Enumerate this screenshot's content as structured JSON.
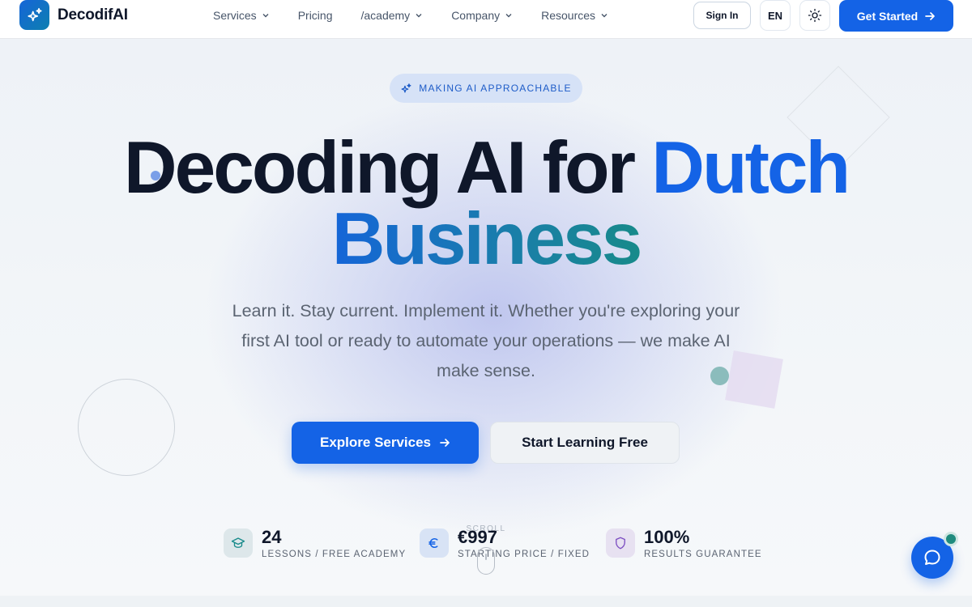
{
  "brand": {
    "name": "DecodifAI"
  },
  "nav": {
    "items": [
      {
        "label": "Services",
        "has_dropdown": true
      },
      {
        "label": "Pricing",
        "has_dropdown": false
      },
      {
        "label": "/academy",
        "has_dropdown": true
      },
      {
        "label": "Company",
        "has_dropdown": true
      },
      {
        "label": "Resources",
        "has_dropdown": true
      }
    ],
    "sign_in": "Sign In",
    "language": "EN",
    "theme_icon": "sun-icon",
    "get_started": "Get Started"
  },
  "hero": {
    "badge": "MAKING AI APPROACHABLE",
    "headline_part1": "Decoding AI for ",
    "headline_accent": "Dutch",
    "headline_line2": "Business",
    "subtitle": "Learn it. Stay current. Implement it. Whether you're exploring your first AI tool or ready to automate your operations — we make AI make sense.",
    "primary_cta": "Explore Services",
    "secondary_cta": "Start Learning Free"
  },
  "stats": [
    {
      "icon": "graduation-cap-icon",
      "value": "24",
      "label": "LESSONS / FREE ACADEMY"
    },
    {
      "icon": "euro-icon",
      "value": "€997",
      "label": "STARTING PRICE / FIXED"
    },
    {
      "icon": "shield-icon",
      "value": "100%",
      "label": "RESULTS GUARANTEE"
    }
  ],
  "scroll_hint": "SCROLL",
  "colors": {
    "primary": "#1463e6",
    "text_dark": "#0f172a",
    "text_muted": "#5b6472",
    "teal": "#178a8a"
  }
}
